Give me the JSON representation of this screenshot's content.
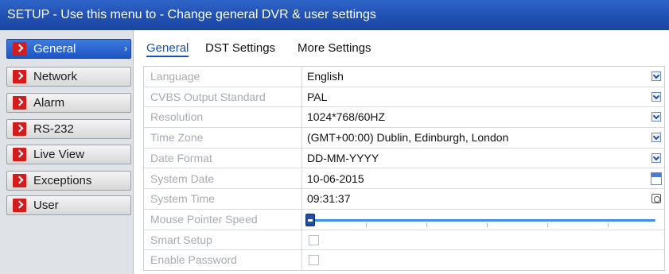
{
  "window": {
    "title": "SETUP - Use this menu to - Change general DVR & user settings"
  },
  "sidebar": {
    "items": [
      {
        "label": "General",
        "active": true
      },
      {
        "label": "Network"
      },
      {
        "label": "Alarm"
      },
      {
        "label": "RS-232"
      },
      {
        "label": "Live View"
      },
      {
        "label": "Exceptions"
      },
      {
        "label": "User"
      }
    ]
  },
  "tabs": [
    {
      "label": "General",
      "active": true
    },
    {
      "label": "DST Settings"
    },
    {
      "label": "More Settings"
    }
  ],
  "settings": {
    "language": {
      "label": "Language",
      "value": "English",
      "control": "dropdown"
    },
    "cvbs": {
      "label": "CVBS Output Standard",
      "value": "PAL",
      "control": "dropdown"
    },
    "resolution": {
      "label": "Resolution",
      "value": "1024*768/60HZ",
      "control": "dropdown"
    },
    "timezone": {
      "label": "Time Zone",
      "value": "(GMT+00:00) Dublin, Edinburgh, London",
      "control": "dropdown"
    },
    "date_format": {
      "label": "Date Format",
      "value": "DD-MM-YYYY",
      "control": "dropdown"
    },
    "system_date": {
      "label": "System Date",
      "value": "10-06-2015",
      "control": "calendar",
      "icon": "calendar-icon"
    },
    "system_time": {
      "label": "System Time",
      "value": "09:31:37",
      "control": "clock",
      "icon": "clock-icon"
    },
    "mouse_speed": {
      "label": "Mouse Pointer Speed",
      "level": 0.0,
      "control": "slider"
    },
    "smart_setup": {
      "label": "Smart Setup",
      "checked": false,
      "control": "checkbox"
    },
    "enable_password": {
      "label": "Enable Password",
      "checked": false,
      "control": "checkbox"
    }
  },
  "colors": {
    "title_bar": "#1f4fb0",
    "active_item": "#1d55c2",
    "arrow_icon": "#d41c1c",
    "slider": "#3f8ee8"
  }
}
